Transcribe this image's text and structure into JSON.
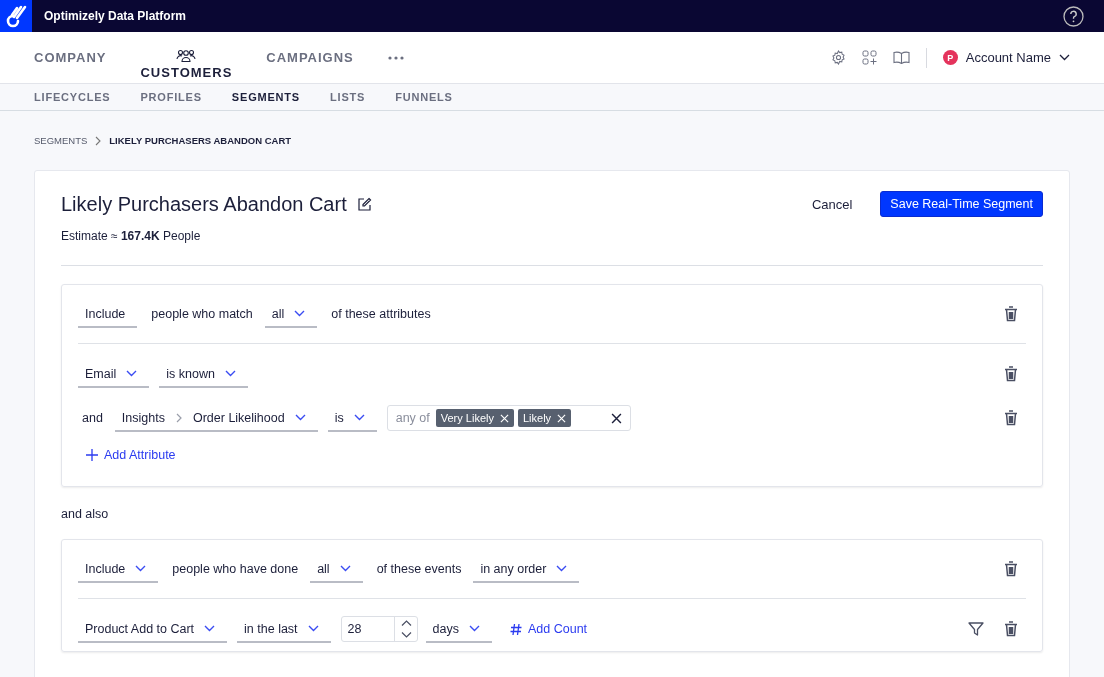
{
  "app": {
    "title": "Optimizely Data Platform"
  },
  "nav": {
    "tabs": [
      {
        "label": "COMPANY",
        "selected": false
      },
      {
        "label": "CUSTOMERS",
        "selected": true
      },
      {
        "label": "CAMPAIGNS",
        "selected": false
      }
    ],
    "account": {
      "initial": "P",
      "name": "Account Name"
    }
  },
  "subnav": [
    {
      "label": "LIFECYCLES",
      "selected": false
    },
    {
      "label": "PROFILES",
      "selected": false
    },
    {
      "label": "SEGMENTS",
      "selected": true
    },
    {
      "label": "LISTS",
      "selected": false
    },
    {
      "label": "FUNNELS",
      "selected": false
    }
  ],
  "breadcrumb": [
    "SEGMENTS",
    "LIKELY PURCHASERS ABANDON CART"
  ],
  "segment": {
    "title": "Likely Purchasers Abandon Cart",
    "estimate": "Estimate ≈ **167.4K** People",
    "cancel": "Cancel",
    "save": "Save Real-Time Segment"
  },
  "groups": [
    {
      "header": {
        "filter": false,
        "parts": [
          {
            "kind": "select",
            "label": "Include",
            "caret": false
          },
          {
            "kind": "text",
            "label": "people who match"
          },
          {
            "kind": "select",
            "label": "all",
            "caret": true
          },
          {
            "kind": "text",
            "label": "of these attributes"
          }
        ]
      },
      "rows": [
        {
          "filter": false,
          "parts": [
            {
              "kind": "select",
              "label": "Email",
              "caret": true
            },
            {
              "kind": "select",
              "label": "is known",
              "caret": true
            }
          ]
        },
        {
          "filter": false,
          "parts": [
            {
              "kind": "text",
              "label": "and"
            },
            {
              "kind": "path",
              "path": [
                "Insights",
                "Order Likelihood"
              ],
              "caret": true
            },
            {
              "kind": "select",
              "label": "is",
              "caret": true
            },
            {
              "kind": "tags",
              "prefix": "any of",
              "tags": [
                "Very Likely",
                "Likely"
              ]
            }
          ]
        }
      ],
      "add_link": "Add Attribute"
    },
    {
      "connector": "and also",
      "header": {
        "filter": false,
        "parts": [
          {
            "kind": "select",
            "label": "Include",
            "caret": true
          },
          {
            "kind": "text",
            "label": "people who have done"
          },
          {
            "kind": "select",
            "label": "all",
            "caret": true
          },
          {
            "kind": "text",
            "label": "of these events"
          },
          {
            "kind": "select",
            "label": "in any order",
            "caret": true
          }
        ]
      },
      "rows": [
        {
          "filter": true,
          "parts": [
            {
              "kind": "select",
              "label": "Product Add to Cart",
              "caret": true
            },
            {
              "kind": "select",
              "label": "in the last",
              "caret": true
            },
            {
              "kind": "number",
              "value": "28"
            },
            {
              "kind": "select",
              "label": "days",
              "caret": true
            },
            {
              "kind": "link",
              "label": "Add Count"
            }
          ]
        }
      ]
    }
  ]
}
